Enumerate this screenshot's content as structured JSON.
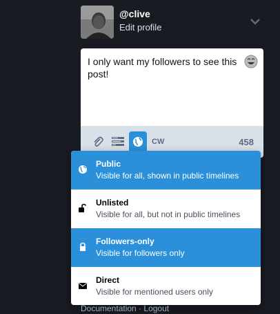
{
  "profile": {
    "handle": "@clive",
    "edit_label": "Edit profile"
  },
  "compose": {
    "text": "I only want my followers to see this post!",
    "char_count": "458",
    "cw_label": "CW"
  },
  "privacy_options": [
    {
      "title": "Public",
      "description": "Visible for all, shown in public timelines",
      "icon": "globe-icon",
      "active": true
    },
    {
      "title": "Unlisted",
      "description": "Visible for all, but not in public timelines",
      "icon": "unlock-icon",
      "active": false
    },
    {
      "title": "Followers-only",
      "description": "Visible for followers only",
      "icon": "lock-icon",
      "active": true
    },
    {
      "title": "Direct",
      "description": "Visible for mentioned users only",
      "icon": "envelope-icon",
      "active": false
    }
  ],
  "footer": {
    "documentation": "Documentation",
    "separator": " · ",
    "logout": "Logout"
  },
  "colors": {
    "background": "#191b22",
    "accent": "#2b90d9",
    "toolbar": "#d9e1e8"
  }
}
